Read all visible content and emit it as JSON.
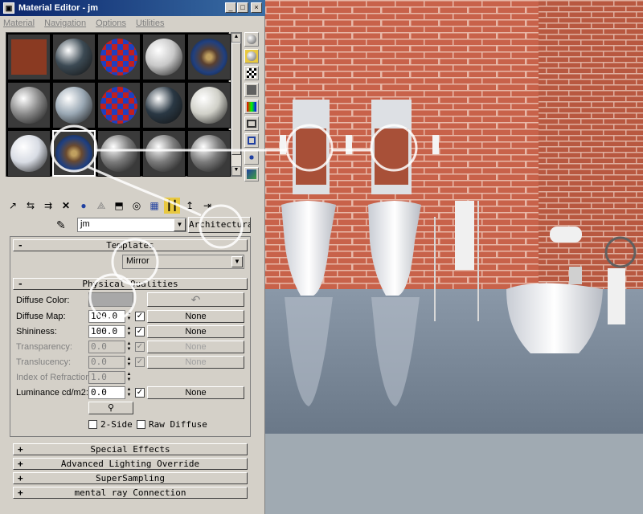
{
  "window": {
    "title": "Material Editor - jm",
    "icon": "material-editor-icon",
    "controls": [
      "_",
      "□",
      "×"
    ]
  },
  "menu": [
    "Material",
    "Navigation",
    "Options",
    "Utilities"
  ],
  "slots": [
    {
      "color": "#8a3a22",
      "type": "brick"
    },
    {
      "color": "#3c4a54",
      "type": "sphere"
    },
    {
      "color": "#4a6a3a",
      "type": "checker"
    },
    {
      "color": "#c8c8c8",
      "type": "sphere"
    },
    {
      "color": "#5a4030",
      "type": "pattern"
    },
    {
      "color": "#8a8a8a",
      "type": "sphere"
    },
    {
      "color": "#9aa8b4",
      "type": "sphere"
    },
    {
      "color": "#3040a0",
      "type": "checker"
    },
    {
      "color": "#2a3844",
      "type": "sphere"
    },
    {
      "color": "#d0d0c8",
      "type": "sphere"
    },
    {
      "color": "#d8dce4",
      "type": "sphere"
    },
    {
      "color": "#6a4a30",
      "type": "pattern"
    },
    {
      "color": "#7a7a7a",
      "type": "sphere"
    },
    {
      "color": "#7a7a7a",
      "type": "sphere"
    },
    {
      "color": "#7a7a7a",
      "type": "sphere"
    }
  ],
  "material_name": "jm",
  "material_type": "Architectural",
  "rollouts": {
    "templates": {
      "sign": "-",
      "label": "Templates",
      "value": "Mirror"
    },
    "physical": {
      "sign": "-",
      "label": "Physical Qualities"
    },
    "special": {
      "sign": "+",
      "label": "Special Effects"
    },
    "advanced": {
      "sign": "+",
      "label": "Advanced Lighting Override"
    },
    "supersampling": {
      "sign": "+",
      "label": "SuperSampling"
    },
    "mentalray": {
      "sign": "+",
      "label": "mental ray Connection"
    }
  },
  "physical": {
    "diffuse_color_label": "Diffuse Color:",
    "diffuse_color": "#a8a8a8",
    "rows": [
      {
        "label": "Diffuse Map:",
        "value": "100.0",
        "map": "None",
        "checked": "✓",
        "enabled": true
      },
      {
        "label": "Shininess:",
        "value": "100.0",
        "map": "None",
        "checked": "✓",
        "enabled": true
      },
      {
        "label": "Transparency:",
        "value": "0.0",
        "map": "None",
        "checked": "✓",
        "enabled": false
      },
      {
        "label": "Translucency:",
        "value": "0.0",
        "map": "None",
        "checked": "✓",
        "enabled": false
      },
      {
        "label": "Index of Refraction:",
        "value": "1.0",
        "map": "",
        "checked": "",
        "enabled": false
      },
      {
        "label": "Luminance cd/m2:",
        "value": "0.0",
        "map": "None",
        "checked": "✓",
        "enabled": true
      }
    ],
    "two_side": "2-Side",
    "raw_diffuse": "Raw Diffuse"
  },
  "colors": {
    "brick": "#c8624a",
    "mortar": "#e8b8a8",
    "floor": "#7a8898"
  }
}
